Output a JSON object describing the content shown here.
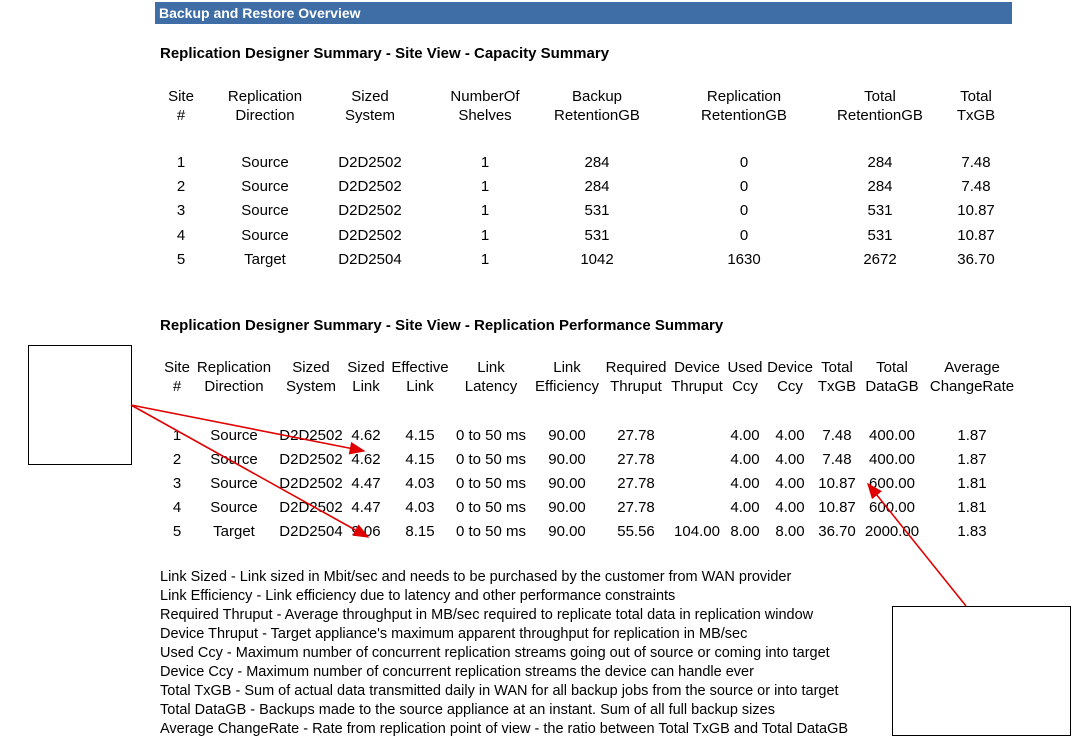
{
  "header": "Backup and Restore Overview",
  "capacity": {
    "title": "Replication Designer Summary - Site View - Capacity Summary",
    "columns": [
      [
        "Site",
        "#"
      ],
      [
        "Replication",
        "Direction"
      ],
      [
        "Sized",
        "System"
      ],
      [
        "NumberOf",
        "Shelves"
      ],
      [
        "Backup",
        "RetentionGB"
      ],
      [
        "Replication",
        "RetentionGB"
      ],
      [
        "Total",
        "RetentionGB"
      ],
      [
        "Total",
        "TxGB"
      ]
    ],
    "rows": [
      [
        "1",
        "Source",
        "D2D2502",
        "1",
        "284",
        "0",
        "284",
        "7.48"
      ],
      [
        "2",
        "Source",
        "D2D2502",
        "1",
        "284",
        "0",
        "284",
        "7.48"
      ],
      [
        "3",
        "Source",
        "D2D2502",
        "1",
        "531",
        "0",
        "531",
        "10.87"
      ],
      [
        "4",
        "Source",
        "D2D2502",
        "1",
        "531",
        "0",
        "531",
        "10.87"
      ],
      [
        "5",
        "Target",
        "D2D2504",
        "1",
        "1042",
        "1630",
        "2672",
        "36.70"
      ]
    ]
  },
  "performance": {
    "title": "Replication Designer Summary - Site View - Replication Performance Summary",
    "columns": [
      [
        "Site",
        "#"
      ],
      [
        "Replication",
        "Direction"
      ],
      [
        "Sized",
        "System"
      ],
      [
        "Sized",
        "Link"
      ],
      [
        "Effective",
        "Link"
      ],
      [
        "Link",
        "Latency"
      ],
      [
        "Link",
        "Efficiency"
      ],
      [
        "Required",
        "Thruput"
      ],
      [
        "Device",
        "Thruput"
      ],
      [
        "Used",
        "Ccy"
      ],
      [
        "Device",
        "Ccy"
      ],
      [
        "Total",
        "TxGB"
      ],
      [
        "Total",
        "DataGB"
      ],
      [
        "Average",
        "ChangeRate"
      ]
    ],
    "rows": [
      [
        "1",
        "Source",
        "D2D2502",
        "4.62",
        "4.15",
        "0 to 50 ms",
        "90.00",
        "27.78",
        "",
        "4.00",
        "4.00",
        "7.48",
        "400.00",
        "1.87"
      ],
      [
        "2",
        "Source",
        "D2D2502",
        "4.62",
        "4.15",
        "0 to 50 ms",
        "90.00",
        "27.78",
        "",
        "4.00",
        "4.00",
        "7.48",
        "400.00",
        "1.87"
      ],
      [
        "3",
        "Source",
        "D2D2502",
        "4.47",
        "4.03",
        "0 to 50 ms",
        "90.00",
        "27.78",
        "",
        "4.00",
        "4.00",
        "10.87",
        "600.00",
        "1.81"
      ],
      [
        "4",
        "Source",
        "D2D2502",
        "4.47",
        "4.03",
        "0 to 50 ms",
        "90.00",
        "27.78",
        "",
        "4.00",
        "4.00",
        "10.87",
        "600.00",
        "1.81"
      ],
      [
        "5",
        "Target",
        "D2D2504",
        "9.06",
        "8.15",
        "0 to 50 ms",
        "90.00",
        "55.56",
        "104.00",
        "8.00",
        "8.00",
        "36.70",
        "2000.00",
        "1.83"
      ]
    ]
  },
  "legend": [
    "Link Sized - Link sized in Mbit/sec and needs to be purchased by the customer from WAN provider",
    "Link Efficiency - Link efficiency due to latency and other performance constraints",
    "Required Thruput - Average throughput in MB/sec required to replicate total data in replication window",
    "Device Thruput - Target appliance's maximum apparent throughput for replication in MB/sec",
    "Used Ccy - Maximum number of concurrent replication streams going out of source or coming into target",
    "Device Ccy - Maximum number of concurrent replication streams the device can handle ever",
    "Total TxGB - Sum of actual data transmitted daily in WAN for all backup jobs from the source or into target",
    "Total DataGB - Backups made to the source appliance at an instant. Sum of all full backup sizes",
    "Average ChangeRate - Rate from replication point of view - the ratio between Total TxGB and Total DataGB"
  ],
  "annotation_color": "#e00000"
}
